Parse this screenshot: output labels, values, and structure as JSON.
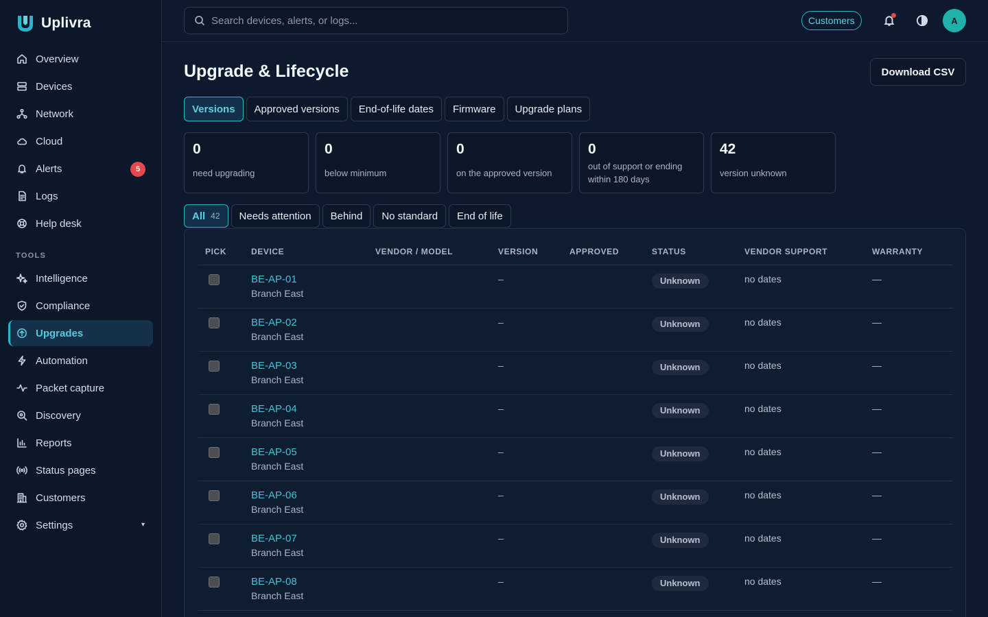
{
  "brand": {
    "name": "Uplivra"
  },
  "sidebar": {
    "items": [
      {
        "label": "Overview",
        "icon": "home-icon"
      },
      {
        "label": "Devices",
        "icon": "server-icon"
      },
      {
        "label": "Network",
        "icon": "network-icon"
      },
      {
        "label": "Cloud",
        "icon": "cloud-icon"
      },
      {
        "label": "Alerts",
        "icon": "bell-icon",
        "badge": "5"
      },
      {
        "label": "Logs",
        "icon": "file-icon"
      },
      {
        "label": "Help desk",
        "icon": "lifebuoy-icon"
      }
    ],
    "tools_heading": "TOOLS",
    "tools": [
      {
        "label": "Intelligence",
        "icon": "sparkle-icon"
      },
      {
        "label": "Compliance",
        "icon": "shield-icon"
      },
      {
        "label": "Upgrades",
        "icon": "upgrade-icon",
        "active": true
      },
      {
        "label": "Automation",
        "icon": "bolt-icon"
      },
      {
        "label": "Packet capture",
        "icon": "pulse-icon"
      },
      {
        "label": "Discovery",
        "icon": "discover-icon"
      },
      {
        "label": "Reports",
        "icon": "chart-icon"
      },
      {
        "label": "Status pages",
        "icon": "broadcast-icon"
      },
      {
        "label": "Customers",
        "icon": "building-icon"
      },
      {
        "label": "Settings",
        "icon": "gear-icon",
        "caret": "▾"
      }
    ]
  },
  "topbar": {
    "search_placeholder": "Search devices, alerts, or logs...",
    "customers_label": "Customers",
    "avatar_initial": "A"
  },
  "page": {
    "title": "Upgrade & Lifecycle",
    "download_label": "Download CSV",
    "tabs": [
      "Versions",
      "Approved versions",
      "End-of-life dates",
      "Firmware",
      "Upgrade plans"
    ],
    "stats": [
      {
        "value": "0",
        "label": "need upgrading"
      },
      {
        "value": "0",
        "label": "below minimum"
      },
      {
        "value": "0",
        "label": "on the approved version"
      },
      {
        "value": "0",
        "label": "out of support or ending within 180 days"
      },
      {
        "value": "42",
        "label": "version unknown"
      }
    ],
    "filters": [
      {
        "label": "All",
        "count": "42"
      },
      {
        "label": "Needs attention"
      },
      {
        "label": "Behind"
      },
      {
        "label": "No standard"
      },
      {
        "label": "End of life"
      }
    ]
  },
  "table": {
    "columns": [
      "PICK",
      "DEVICE",
      "VENDOR / MODEL",
      "VERSION",
      "APPROVED",
      "STATUS",
      "VENDOR SUPPORT",
      "WARRANTY"
    ],
    "rows": [
      {
        "device": "BE-AP-01",
        "site": "Branch East",
        "vendor": "",
        "version": "–",
        "approved": "",
        "status": "Unknown",
        "support": "no dates",
        "warranty": "—"
      },
      {
        "device": "BE-AP-02",
        "site": "Branch East",
        "vendor": "",
        "version": "–",
        "approved": "",
        "status": "Unknown",
        "support": "no dates",
        "warranty": "—"
      },
      {
        "device": "BE-AP-03",
        "site": "Branch East",
        "vendor": "",
        "version": "–",
        "approved": "",
        "status": "Unknown",
        "support": "no dates",
        "warranty": "—"
      },
      {
        "device": "BE-AP-04",
        "site": "Branch East",
        "vendor": "",
        "version": "–",
        "approved": "",
        "status": "Unknown",
        "support": "no dates",
        "warranty": "—"
      },
      {
        "device": "BE-AP-05",
        "site": "Branch East",
        "vendor": "",
        "version": "–",
        "approved": "",
        "status": "Unknown",
        "support": "no dates",
        "warranty": "—"
      },
      {
        "device": "BE-AP-06",
        "site": "Branch East",
        "vendor": "",
        "version": "–",
        "approved": "",
        "status": "Unknown",
        "support": "no dates",
        "warranty": "—"
      },
      {
        "device": "BE-AP-07",
        "site": "Branch East",
        "vendor": "",
        "version": "–",
        "approved": "",
        "status": "Unknown",
        "support": "no dates",
        "warranty": "—"
      },
      {
        "device": "BE-AP-08",
        "site": "Branch East",
        "vendor": "",
        "version": "–",
        "approved": "",
        "status": "Unknown",
        "support": "no dates",
        "warranty": "—"
      }
    ]
  }
}
